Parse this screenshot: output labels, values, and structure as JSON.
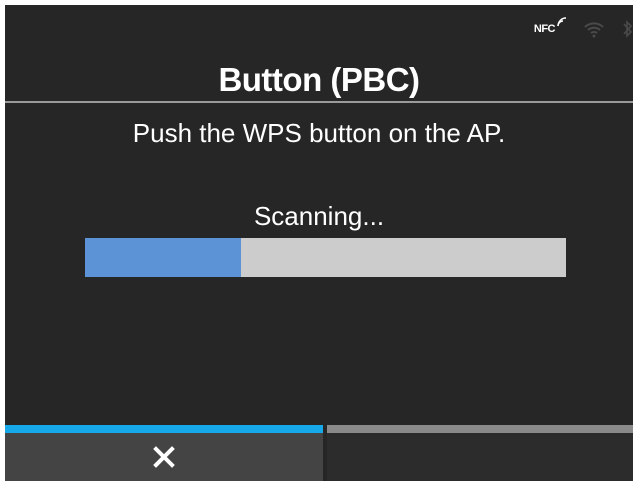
{
  "status_bar": {
    "nfc_label": "NFC",
    "icons": [
      "nfc-icon",
      "wifi-icon",
      "bluetooth-icon"
    ]
  },
  "dialog": {
    "title": "Button (PBC)",
    "message": "Push the WPS button on the AP.",
    "status_text": "Scanning...",
    "progress": 0.325
  },
  "softkeys": {
    "left": {
      "icon": "close-icon"
    },
    "right": {
      "icon": ""
    }
  },
  "colors": {
    "background": "#262626",
    "progress_fill": "#5b93d6",
    "progress_track": "#cccccc",
    "active_key_accent": "#16a8e8",
    "inactive_key_accent": "#8a8a8a"
  }
}
